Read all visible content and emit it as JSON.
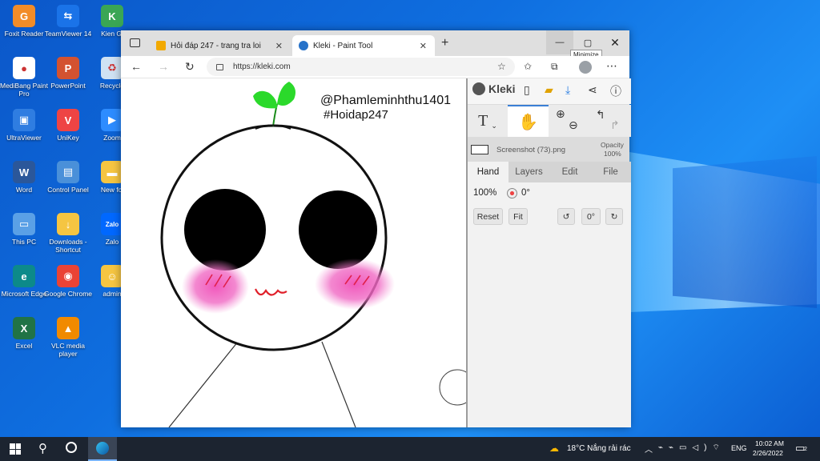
{
  "desktop": {
    "icons": [
      {
        "label": "Foxit Reader",
        "color": "#f28c28",
        "glyph": "G"
      },
      {
        "label": "TeamViewer 14",
        "color": "#1a73e8",
        "glyph": "⇆"
      },
      {
        "label": "Kien Gi",
        "color": "#3aa655",
        "glyph": "K"
      },
      {
        "label": "MediBang Paint Pro",
        "color": "#ffffff",
        "glyph": "●"
      },
      {
        "label": "PowerPoint",
        "color": "#d35230",
        "glyph": "P"
      },
      {
        "label": "Recycle",
        "color": "#cfe2f3",
        "glyph": "♻"
      },
      {
        "label": "UltraViewer",
        "color": "#2f7de1",
        "glyph": "▣"
      },
      {
        "label": "UniKey",
        "color": "#e44",
        "glyph": "V"
      },
      {
        "label": "Zoom",
        "color": "#2d8cff",
        "glyph": "▶"
      },
      {
        "label": "Word",
        "color": "#2b579a",
        "glyph": "W"
      },
      {
        "label": "Control Panel",
        "color": "#4a90d9",
        "glyph": "▤"
      },
      {
        "label": "New fol",
        "color": "#f5c542",
        "glyph": "▬"
      },
      {
        "label": "This PC",
        "color": "#5aa0e6",
        "glyph": "▭"
      },
      {
        "label": "Downloads - Shortcut",
        "color": "#f5c542",
        "glyph": "↓"
      },
      {
        "label": "Zalo",
        "color": "#0068ff",
        "glyph": "Zalo"
      },
      {
        "label": "Microsoft Edge",
        "color": "#0c8a8a",
        "glyph": "e"
      },
      {
        "label": "Google Chrome",
        "color": "#ea4335",
        "glyph": "◉"
      },
      {
        "label": "admin",
        "color": "#f5c542",
        "glyph": "☺"
      },
      {
        "label": "Excel",
        "color": "#217346",
        "glyph": "X"
      },
      {
        "label": "VLC media player",
        "color": "#f18a00",
        "glyph": "▲"
      }
    ]
  },
  "browser": {
    "tabs": [
      {
        "title": "Hỏi đáp 247 - trang tra loi",
        "favicon_color": "#f2a900"
      },
      {
        "title": "Kleki - Paint Tool",
        "favicon_color": "#2672c9"
      }
    ],
    "url": "https://kleki.com",
    "tooltip": "Minimize"
  },
  "kleki": {
    "logo": "Kleki",
    "layer_name": "Screenshot (73).png",
    "opacity_label": "Opacity",
    "opacity_value": "100%",
    "tabs": [
      "Hand",
      "Layers",
      "Edit",
      "File"
    ],
    "zoom": "100%",
    "rotation": "0°",
    "buttons": {
      "reset": "Reset",
      "fit": "Fit",
      "angle": "0°"
    }
  },
  "drawing": {
    "line1": "@Phamleminhthu1401",
    "line2": "#Hoidap247"
  },
  "taskbar": {
    "weather": "18°C Nắng rải rác",
    "language": "ENG",
    "time": "10:02 AM",
    "date": "2/26/2022",
    "notifications": "2"
  }
}
